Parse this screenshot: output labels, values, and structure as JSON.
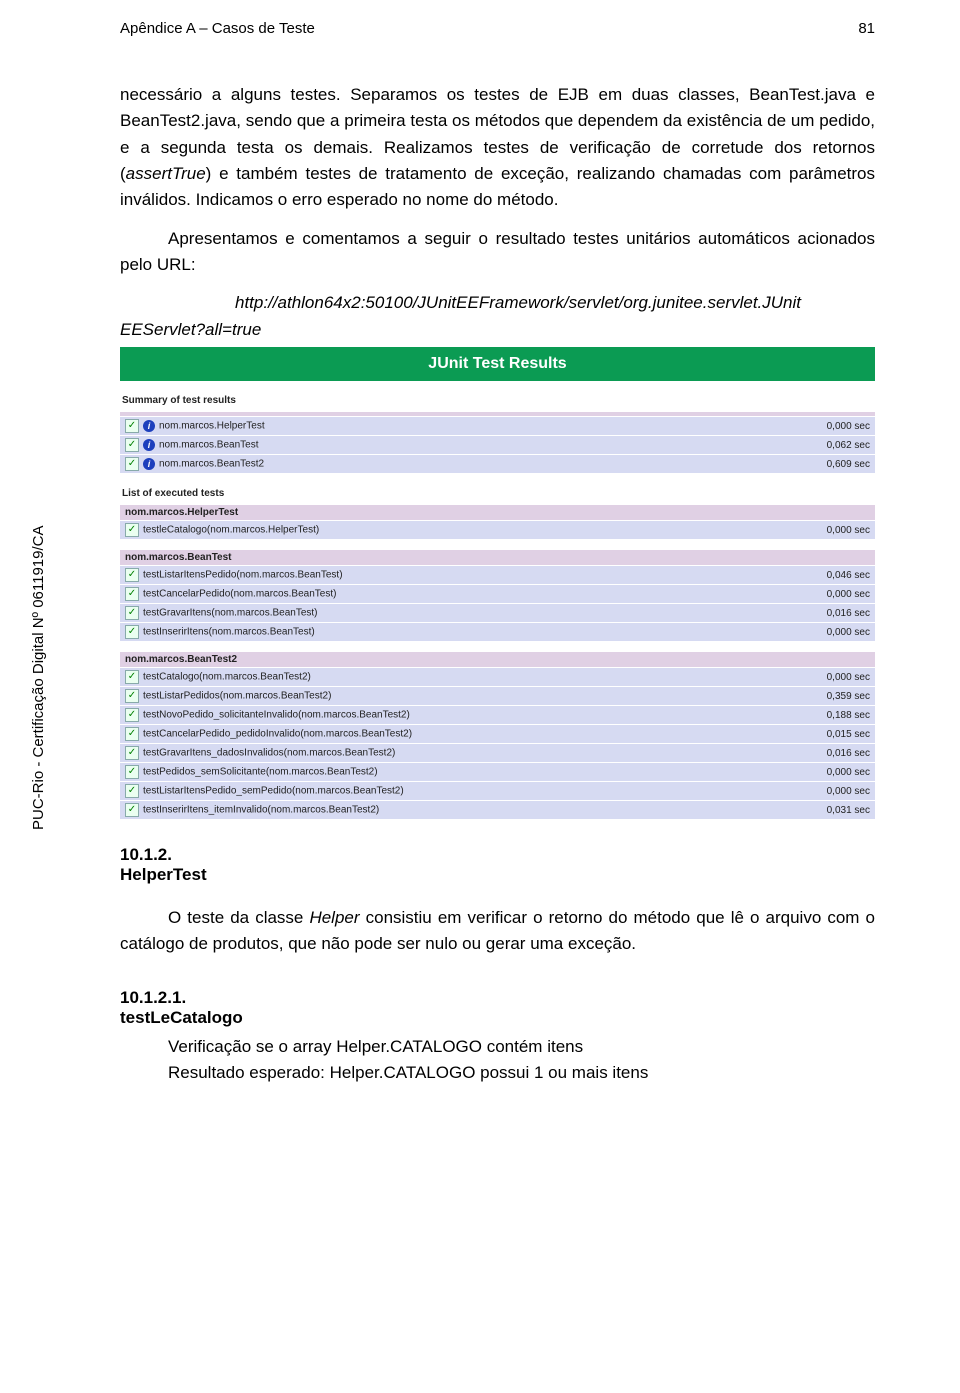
{
  "header": {
    "title": "Apêndice A – Casos de Teste",
    "page": "81"
  },
  "sidelabel": "PUC-Rio - Certificação Digital Nº 0611919/CA",
  "para1": "necessário a alguns testes. Separamos os testes de EJB em duas classes, BeanTest.java e BeanTest2.java, sendo que a primeira testa os métodos que dependem da existência de um pedido, e a segunda testa os demais. Realizamos testes de verificação de corretude dos retornos (",
  "para1_it": "assertTrue",
  "para1b": ") e também testes de tratamento de exceção, realizando chamadas com parâmetros inválidos. Indicamos o erro esperado no nome do método.",
  "para2": "Apresentamos e comentamos a seguir o resultado testes unitários automáticos acionados pelo URL:",
  "url": "http://athlon64x2:50100/JUnitEEFramework/servlet/org.junitee.servlet.JUnit",
  "eeserv": "EEServlet?all=true",
  "junit": {
    "banner": "JUnit Test Results",
    "summary_title": "Summary of test results",
    "summary": [
      {
        "name": "nom.marcos.HelperTest",
        "time": "0,000 sec"
      },
      {
        "name": "nom.marcos.BeanTest",
        "time": "0,062 sec"
      },
      {
        "name": "nom.marcos.BeanTest2",
        "time": "0,609 sec"
      }
    ],
    "list_title": "List of executed tests",
    "groups": [
      {
        "name": "nom.marcos.HelperTest",
        "rows": [
          {
            "name": "testleCatalogo(nom.marcos.HelperTest)",
            "time": "0,000 sec"
          }
        ]
      },
      {
        "name": "nom.marcos.BeanTest",
        "rows": [
          {
            "name": "testListarItensPedido(nom.marcos.BeanTest)",
            "time": "0,046 sec"
          },
          {
            "name": "testCancelarPedido(nom.marcos.BeanTest)",
            "time": "0,000 sec"
          },
          {
            "name": "testGravarItens(nom.marcos.BeanTest)",
            "time": "0,016 sec"
          },
          {
            "name": "testInserirItens(nom.marcos.BeanTest)",
            "time": "0,000 sec"
          }
        ]
      },
      {
        "name": "nom.marcos.BeanTest2",
        "rows": [
          {
            "name": "testCatalogo(nom.marcos.BeanTest2)",
            "time": "0,000 sec"
          },
          {
            "name": "testListarPedidos(nom.marcos.BeanTest2)",
            "time": "0,359 sec"
          },
          {
            "name": "testNovoPedido_solicitanteInvalido(nom.marcos.BeanTest2)",
            "time": "0,188 sec"
          },
          {
            "name": "testCancelarPedido_pedidoInvalido(nom.marcos.BeanTest2)",
            "time": "0,015 sec"
          },
          {
            "name": "testGravarItens_dadosInvalidos(nom.marcos.BeanTest2)",
            "time": "0,016 sec"
          },
          {
            "name": "testPedidos_semSolicitante(nom.marcos.BeanTest2)",
            "time": "0,000 sec"
          },
          {
            "name": "testListarItensPedido_semPedido(nom.marcos.BeanTest2)",
            "time": "0,000 sec"
          },
          {
            "name": "testInserirItens_itemInvalido(nom.marcos.BeanTest2)",
            "time": "0,031 sec"
          }
        ]
      }
    ]
  },
  "sec1num": "10.1.2.",
  "sec1title": "HelperTest",
  "para3a": "O teste da classe ",
  "para3_it": "Helper",
  "para3b": " consistiu em verificar o retorno do método que lê o arquivo com o catálogo de produtos, que não pode ser nulo ou gerar uma exceção.",
  "sec2num": "10.1.2.1.",
  "sec2title": "testLeCatalogo",
  "line1": "Verificação se o array Helper.CATALOGO contém itens",
  "line2": "Resultado esperado: Helper.CATALOGO possui 1 ou mais itens"
}
